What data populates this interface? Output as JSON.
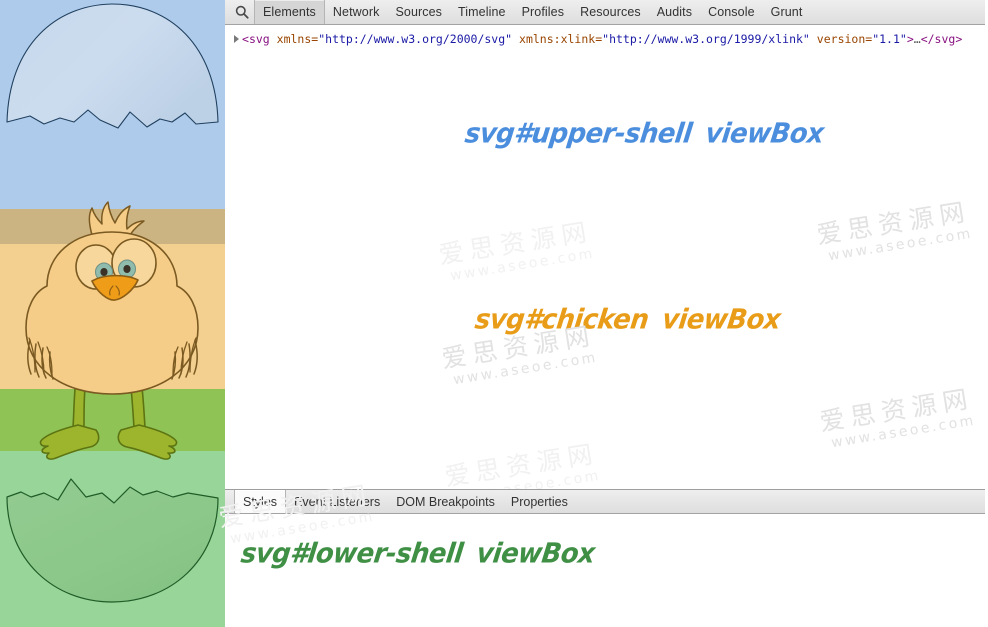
{
  "toolbar": {
    "search_icon": "search-icon",
    "tabs": [
      {
        "label": "Elements",
        "selected": true
      },
      {
        "label": "Network",
        "selected": false
      },
      {
        "label": "Sources",
        "selected": false
      },
      {
        "label": "Timeline",
        "selected": false
      },
      {
        "label": "Profiles",
        "selected": false
      },
      {
        "label": "Resources",
        "selected": false
      },
      {
        "label": "Audits",
        "selected": false
      },
      {
        "label": "Console",
        "selected": false
      },
      {
        "label": "Grunt",
        "selected": false
      }
    ]
  },
  "dom": {
    "disclosure_icon": "triangle-right-icon",
    "open_bracket": "<",
    "tag_name": "svg",
    "attributes": [
      {
        "name": "xmlns",
        "eq": "=",
        "value": "\"http://www.w3.org/2000/svg\""
      },
      {
        "name": "xmlns:xlink",
        "eq": "=",
        "value": "\"http://www.w3.org/1999/xlink\""
      },
      {
        "name": "version",
        "eq": "=",
        "value": "\"1.1\""
      }
    ],
    "close_bracket": ">",
    "ellipsis": "…",
    "closing_tag": "</svg>"
  },
  "annotations": [
    {
      "id": "upper",
      "text": "svg#upper-shell",
      "suffix": "viewBox",
      "color": "#4c8ede"
    },
    {
      "id": "chick",
      "text": "svg#chicken",
      "suffix": "viewBox",
      "color": "#e89c18"
    },
    {
      "id": "lower",
      "text": "svg#lower-shell",
      "suffix": "viewBox",
      "color": "#3f8f45"
    }
  ],
  "watermark": {
    "cn": "爱思资源网",
    "en": "www.aseoe.com"
  },
  "bottom_panel": {
    "tabs": [
      {
        "label": "Styles",
        "selected": true
      },
      {
        "label": "Event Listeners",
        "selected": false
      },
      {
        "label": "DOM Breakpoints",
        "selected": false
      },
      {
        "label": "Properties",
        "selected": false
      }
    ]
  },
  "preview": {
    "bands": [
      {
        "name": "upper-shell-band",
        "color": "#aecbeb"
      },
      {
        "name": "chick-head-band",
        "color": "#cbb482"
      },
      {
        "name": "chick-body-band",
        "color": "#f3d08f"
      },
      {
        "name": "grass-band",
        "color": "#8fc355"
      },
      {
        "name": "lower-shell-band",
        "color": "#98d598"
      }
    ],
    "artwork": [
      {
        "name": "upper-shell-illustration",
        "fill": "#cfdcec",
        "stroke": "#1f3c5c"
      },
      {
        "name": "chick-illustration",
        "fill": "#f5cd88",
        "stroke": "#7a5a22"
      },
      {
        "name": "lower-shell-illustration",
        "fill": "#8fcc8c",
        "stroke": "#1f5c28"
      }
    ]
  }
}
